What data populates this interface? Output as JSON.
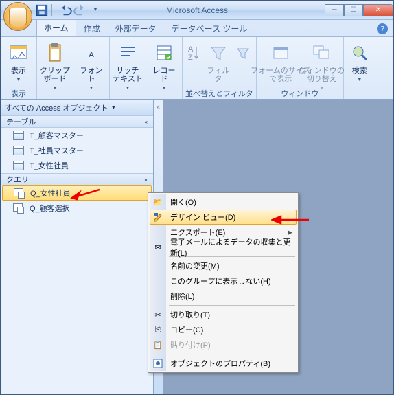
{
  "window": {
    "title": "Microsoft Access",
    "qat": [
      "save-icon",
      "undo-icon",
      "redo-icon"
    ]
  },
  "tabs": {
    "items": [
      "ホーム",
      "作成",
      "外部データ",
      "データベース ツール"
    ],
    "active_index": 0
  },
  "ribbon": {
    "groups": [
      {
        "label": "表示",
        "buttons": [
          {
            "label": "表示",
            "icon": "view-icon"
          }
        ]
      },
      {
        "label": "クリップボード",
        "buttons": [
          {
            "label": "クリップ\nボード",
            "icon": "clipboard-icon"
          }
        ]
      },
      {
        "label": "フォント",
        "buttons": [
          {
            "label": "フォント",
            "icon": "font-icon"
          }
        ]
      },
      {
        "label": "リッチ テキスト",
        "buttons": [
          {
            "label": "リッチ\nテキスト",
            "icon": "richtext-icon"
          }
        ]
      },
      {
        "label": "レコード",
        "buttons": [
          {
            "label": "レコード",
            "icon": "records-icon"
          }
        ]
      },
      {
        "label": "並べ替えとフィルタ",
        "buttons": [
          {
            "label": "",
            "icon": "sort-icon"
          },
          {
            "label": "フィルタ",
            "icon": "filter-icon"
          },
          {
            "label": "",
            "icon": "advfilter-icon"
          }
        ]
      },
      {
        "label": "ウィンドウ",
        "buttons": [
          {
            "label": "フォームのサイズ\nで表示",
            "icon": "formsize-icon"
          },
          {
            "label": "ウィンドウの\n切り替え",
            "icon": "switchwin-icon"
          }
        ]
      },
      {
        "label": "検索",
        "buttons": [
          {
            "label": "検索",
            "icon": "find-icon"
          }
        ]
      }
    ]
  },
  "navpane": {
    "header": "すべての Access オブジェクト",
    "sections": [
      {
        "label": "テーブル",
        "items": [
          "T_顧客マスター",
          "T_社員マスター",
          "T_女性社員"
        ]
      },
      {
        "label": "クエリ",
        "items": [
          "Q_女性社員",
          "Q_顧客選択"
        ],
        "selected_index": 0
      }
    ]
  },
  "contextmenu": {
    "items": [
      {
        "label": "開く(O)",
        "icon": "open-icon"
      },
      {
        "label": "デザイン ビュー(D)",
        "icon": "design-icon",
        "highlighted": true
      },
      {
        "label": "エクスポート(E)",
        "submenu": true
      },
      {
        "label": "電子メールによるデータの収集と更新(L)",
        "icon": "mail-icon"
      },
      {
        "sep": true
      },
      {
        "label": "名前の変更(M)"
      },
      {
        "label": "このグループに表示しない(H)"
      },
      {
        "label": "削除(L)"
      },
      {
        "sep": true
      },
      {
        "label": "切り取り(T)",
        "icon": "cut-icon"
      },
      {
        "label": "コピー(C)",
        "icon": "copy-icon"
      },
      {
        "label": "貼り付け(P)",
        "icon": "paste-icon",
        "disabled": true
      },
      {
        "sep": true
      },
      {
        "label": "オブジェクトのプロパティ(B)",
        "icon": "props-icon"
      }
    ]
  }
}
